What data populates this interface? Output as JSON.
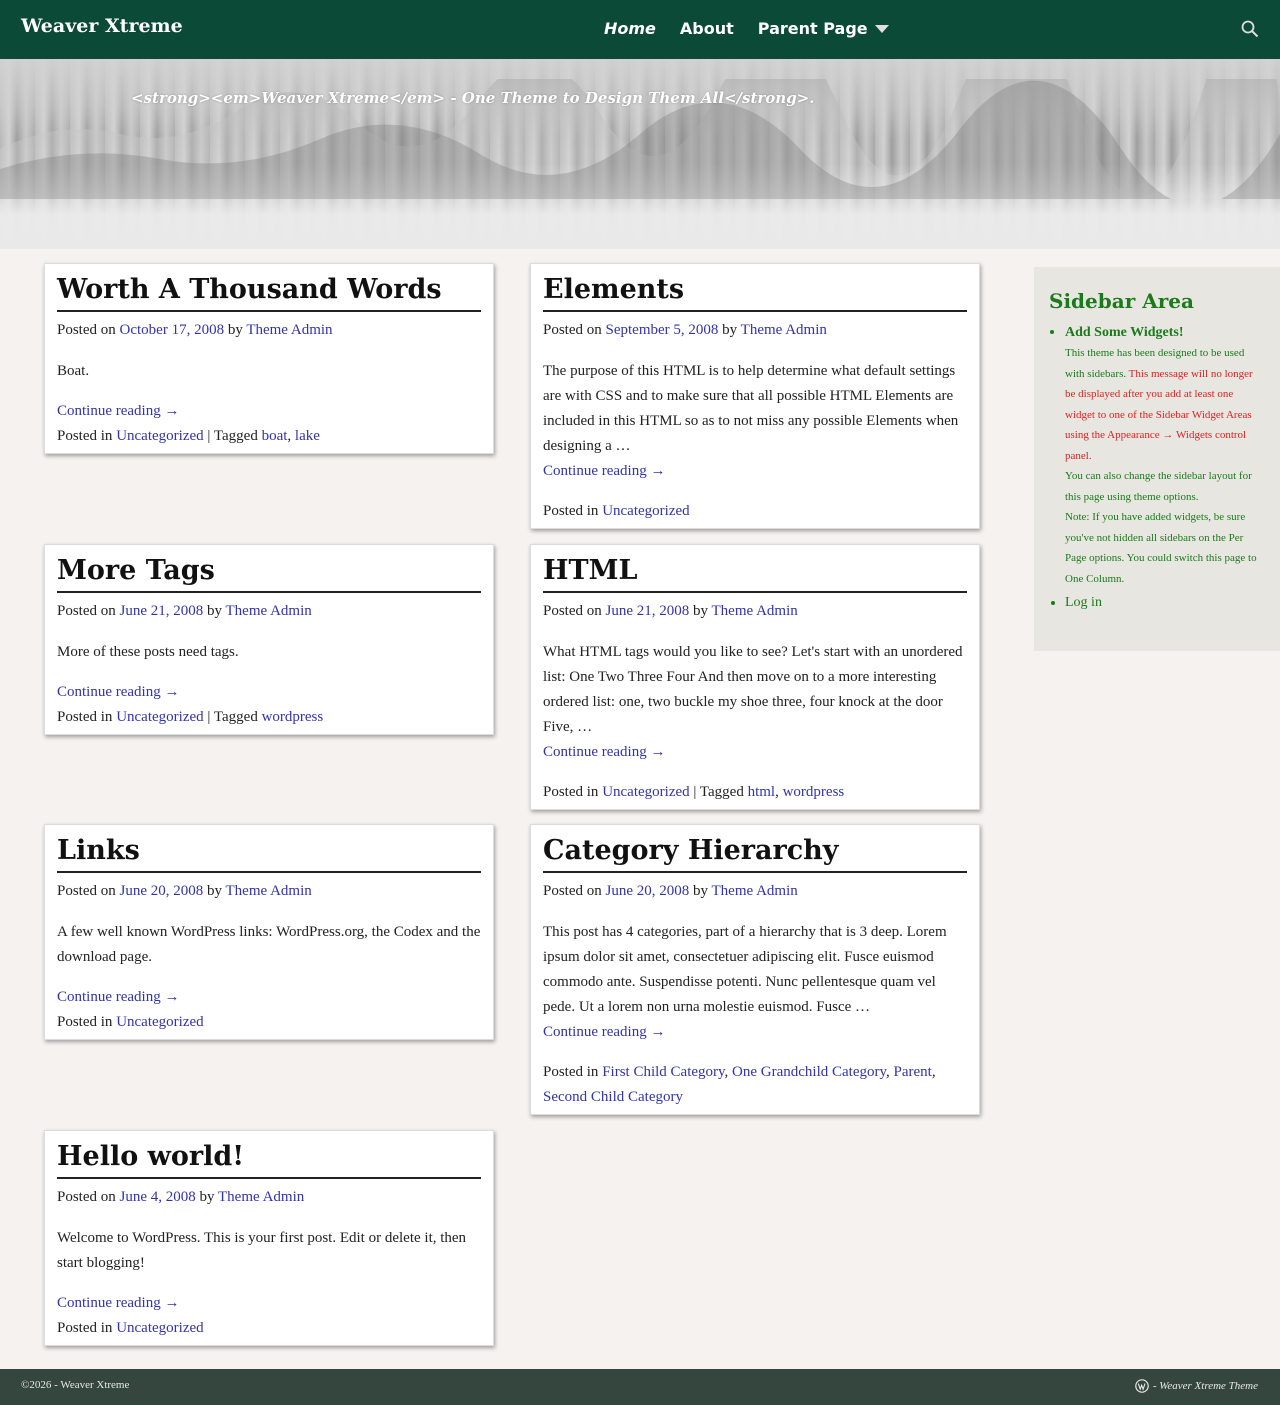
{
  "site": {
    "title": "Weaver Xtreme",
    "tagline": "<strong><em>Weaver Xtreme</em> - One Theme to Design Them All</strong>."
  },
  "nav": {
    "items": [
      "Home",
      "About",
      "Parent Page"
    ]
  },
  "posts": [
    {
      "title": "Worth A Thousand Words",
      "posted_on_label": "Posted on",
      "date": "October 17, 2008",
      "by_label": "by",
      "author": "Theme Admin",
      "excerpt": "Boat.",
      "continue": "Continue reading →",
      "posted_in_label": "Posted in",
      "categories": [
        "Uncategorized"
      ],
      "tagged_label": "Tagged",
      "tags": [
        "boat",
        "lake"
      ]
    },
    {
      "title": "Elements",
      "posted_on_label": "Posted on",
      "date": "September 5, 2008",
      "by_label": "by",
      "author": "Theme Admin",
      "excerpt": "The purpose of this HTML is to help determine what default settings are with CSS and to make sure that all possible HTML Elements are included in this HTML so as to not miss any possible Elements when designing a …",
      "continue": "Continue reading →",
      "posted_in_label": "Posted in",
      "categories": [
        "Uncategorized"
      ]
    },
    {
      "title": "More Tags",
      "posted_on_label": "Posted on",
      "date": "June 21, 2008",
      "by_label": "by",
      "author": "Theme Admin",
      "excerpt": "More of these posts need tags.",
      "continue": "Continue reading →",
      "posted_in_label": "Posted in",
      "categories": [
        "Uncategorized"
      ],
      "tagged_label": "Tagged",
      "tags": [
        "wordpress"
      ]
    },
    {
      "title": "HTML",
      "posted_on_label": "Posted on",
      "date": "June 21, 2008",
      "by_label": "by",
      "author": "Theme Admin",
      "excerpt": "What HTML tags would you like to see? Let's start with an unordered list: One Two Three Four And then move on to a more interesting ordered list: one, two buckle my shoe three, four knock at the door Five, …",
      "continue": "Continue reading →",
      "posted_in_label": "Posted in",
      "categories": [
        "Uncategorized"
      ],
      "tagged_label": "Tagged",
      "tags": [
        "html",
        "wordpress"
      ]
    },
    {
      "title": "Links",
      "posted_on_label": "Posted on",
      "date": "June 20, 2008",
      "by_label": "by",
      "author": "Theme Admin",
      "excerpt": "A few well known WordPress links: WordPress.org, the Codex and the download page.",
      "continue": "Continue reading →",
      "posted_in_label": "Posted in",
      "categories": [
        "Uncategorized"
      ]
    },
    {
      "title": "Category Hierarchy",
      "posted_on_label": "Posted on",
      "date": "June 20, 2008",
      "by_label": "by",
      "author": "Theme Admin",
      "excerpt": "This post has 4 categories, part of a hierarchy that is 3 deep. Lorem ipsum dolor sit amet, consectetuer adipiscing elit. Fusce euismod commodo ante. Suspendisse potenti. Nunc pellentesque quam vel pede. Ut a lorem non urna molestie euismod. Fusce …",
      "continue": "Continue reading →",
      "posted_in_label": "Posted in",
      "categories": [
        "First Child Category",
        "One Grandchild Category",
        "Parent",
        "Second Child Category"
      ]
    },
    {
      "title": "Hello world!",
      "posted_on_label": "Posted on",
      "date": "June 4, 2008",
      "by_label": "by",
      "author": "Theme Admin",
      "excerpt": "Welcome to WordPress. This is your first post. Edit or delete it, then start blogging!",
      "continue": "Continue reading →",
      "posted_in_label": "Posted in",
      "categories": [
        "Uncategorized"
      ]
    }
  ],
  "sidebar": {
    "title": "Sidebar Area",
    "widget_heading": "Add Some Widgets!",
    "note1": "This theme has been designed to be used with sidebars.",
    "note1_red": "This message will no longer be displayed after you add at least one widget to one of the Sidebar Widget Areas using the Appearance → Widgets control panel.",
    "note2": "You can also change the sidebar layout for this page using theme options.",
    "note3": "Note: If you have added widgets, be sure you've not hidden all sidebars on the Per Page options. You could switch this page to One Column.",
    "login": "Log in"
  },
  "footer": {
    "copyright": "©2026 - Weaver Xtreme",
    "credit": "- Weaver Xtreme Theme"
  },
  "colors": {
    "nav_bg": "#0c4a38",
    "footer_bg": "#35463f",
    "sidebar_title": "#1b7a1b",
    "link": "#3333aa",
    "warning": "#dd2222"
  }
}
